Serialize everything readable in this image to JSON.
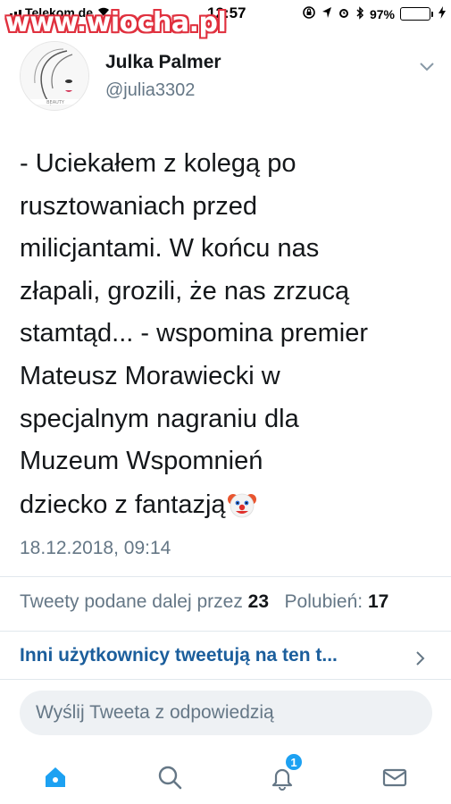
{
  "status_bar": {
    "carrier": "Telekom.de",
    "time": "12:57",
    "battery_percent": "97%",
    "battery_level": 0.97
  },
  "watermark": "www.wiocha.pl",
  "tweet": {
    "display_name": "Julka Palmer",
    "handle": "@julia3302",
    "text_lines": [
      "- Uciekałem z kolegą po",
      "rusztowaniach przed",
      "milicjantami. W końcu nas",
      "złapali, grozili, że nas zrzucą",
      "stamtąd... - wspomina premier",
      "Mateusz Morawiecki w",
      "specjalnym nagraniu dla",
      "Muzeum Wspomnień"
    ],
    "extra_text": "dziecko z fantazją",
    "timestamp": "18.12.2018, 09:14"
  },
  "stats": {
    "retweets_label": "Tweety podane dalej przez",
    "retweets_count": "23",
    "likes_label": "Polubień:",
    "likes_count": "17"
  },
  "others_link": "Inni użytkownicy tweetują na ten t...",
  "reply": {
    "placeholder": "Wyślij Tweeta z odpowiedzią"
  },
  "nav": {
    "notifications_badge": "1"
  },
  "colors": {
    "accent": "#1da1f2",
    "link": "#1b5e9c",
    "muted": "#657786",
    "text": "#14171a"
  }
}
